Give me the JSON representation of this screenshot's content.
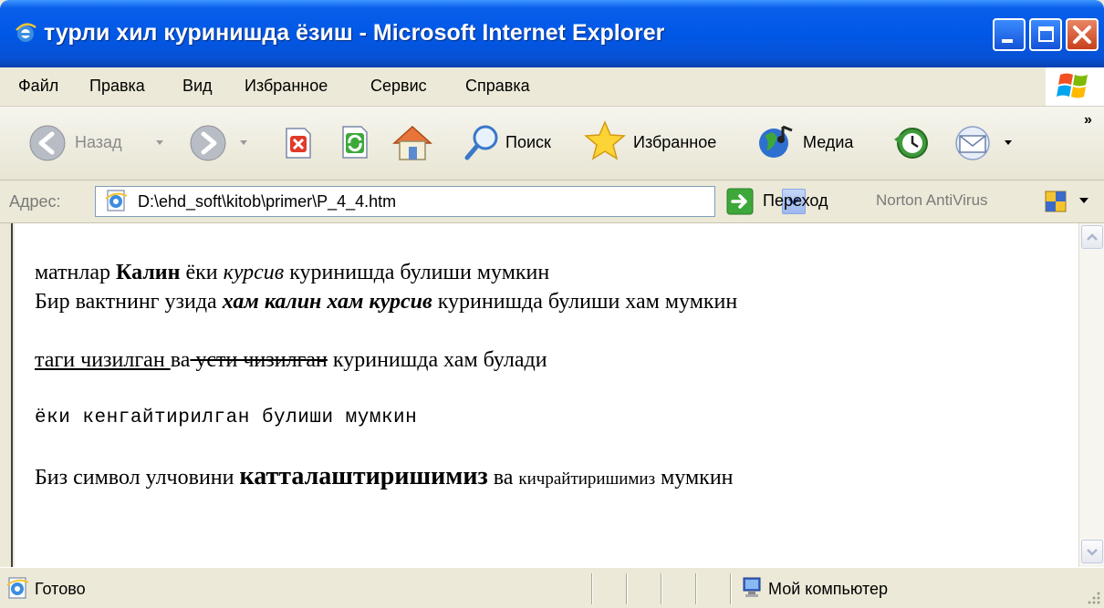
{
  "window": {
    "title": "турли хил куринишда ёзиш - Microsoft Internet Explorer"
  },
  "menu": [
    "Файл",
    "Правка",
    "Вид",
    "Избранное",
    "Сервис",
    "Справка"
  ],
  "toolbar": {
    "back_label": "Назад",
    "search_label": "Поиск",
    "favorites_label": "Избранное",
    "media_label": "Медиа",
    "overflow": "»"
  },
  "address": {
    "label": "Адрес:",
    "url": "D:\\ehd_soft\\kitob\\primer\\P_4_4.htm",
    "go_label": "Переход",
    "norton_label": "Norton AntiVirus"
  },
  "document": {
    "line1": {
      "a": "матнлар ",
      "b": "Калин",
      "c": " ёки ",
      "d": "курсив",
      "e": " куринишда булиши мумкин"
    },
    "line2": {
      "a": "Бир вактнинг узида ",
      "b": "хам калин хам курсив",
      "c": " куринишда булиши хам мумкин"
    },
    "line3": {
      "a": "таги чизилган ",
      "b": "ва",
      "c": " усти чизилган",
      "d": " куринишда хам булади"
    },
    "line4": "ёки кенгайтирилган  булиши мумкин",
    "line5": {
      "a": "Биз символ улчовини ",
      "b": "катталаштиришимиз",
      "c": " ва ",
      "d": "кичрайтиришимиз",
      "e": " мумкин"
    }
  },
  "status": {
    "text": "Готово",
    "zone": "Мой компьютер"
  }
}
